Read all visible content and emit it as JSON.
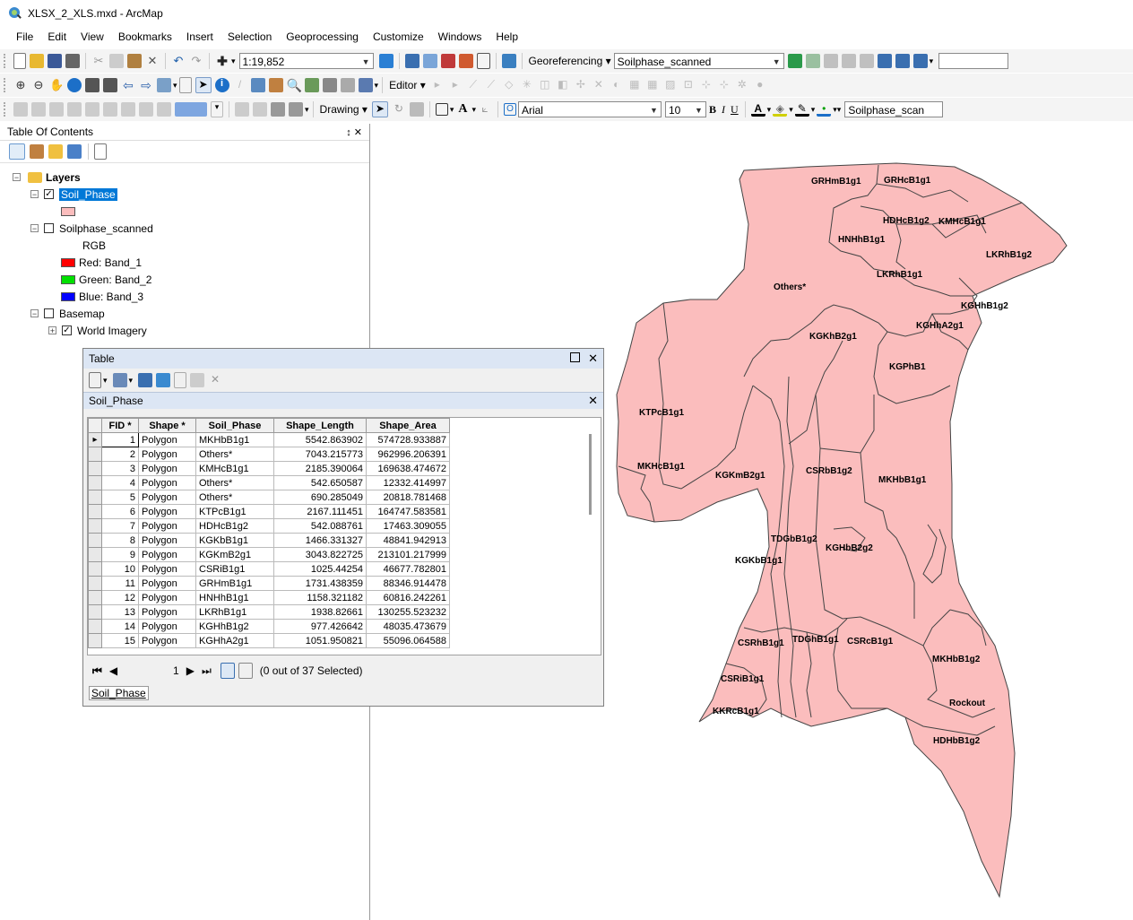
{
  "window": {
    "title": "XLSX_2_XLS.mxd - ArcMap"
  },
  "menu": [
    "File",
    "Edit",
    "View",
    "Bookmarks",
    "Insert",
    "Selection",
    "Geoprocessing",
    "Customize",
    "Windows",
    "Help"
  ],
  "toolbar": {
    "scale": "1:19,852",
    "georeferencing_label": "Georeferencing ▾",
    "georef_layer": "Soilphase_scanned",
    "editor_label": "Editor ▾",
    "drawing_label": "Drawing ▾",
    "font_name": "Arial",
    "font_size": "10",
    "bold": "B",
    "italic": "I",
    "underline": "U",
    "layer_combo": "Soilphase_scan"
  },
  "toc": {
    "title": "Table Of Contents",
    "pin": "↕ ✕",
    "layers_group": "Layers",
    "soil_phase": "Soil_Phase",
    "soilphase_scanned": "Soilphase_scanned",
    "rgb": "RGB",
    "red": "Red:   Band_1",
    "green": "Green: Band_2",
    "blue": "Blue:  Band_3",
    "basemap": "Basemap",
    "world_imagery": "World Imagery"
  },
  "table_window": {
    "title": "Table",
    "layer_tab": "Soil_Phase",
    "columns": [
      "FID *",
      "Shape *",
      "Soil_Phase",
      "Shape_Length",
      "Shape_Area"
    ],
    "rows": [
      [
        "1",
        "Polygon",
        "MKHbB1g1",
        "5542.863902",
        "574728.933887"
      ],
      [
        "2",
        "Polygon",
        "Others*",
        "7043.215773",
        "962996.206391"
      ],
      [
        "3",
        "Polygon",
        "KMHcB1g1",
        "2185.390064",
        "169638.474672"
      ],
      [
        "4",
        "Polygon",
        "Others*",
        "542.650587",
        "12332.414997"
      ],
      [
        "5",
        "Polygon",
        "Others*",
        "690.285049",
        "20818.781468"
      ],
      [
        "6",
        "Polygon",
        "KTPcB1g1",
        "2167.111451",
        "164747.583581"
      ],
      [
        "7",
        "Polygon",
        "HDHcB1g2",
        "542.088761",
        "17463.309055"
      ],
      [
        "8",
        "Polygon",
        "KGKbB1g1",
        "1466.331327",
        "48841.942913"
      ],
      [
        "9",
        "Polygon",
        "KGKmB2g1",
        "3043.822725",
        "213101.217999"
      ],
      [
        "10",
        "Polygon",
        "CSRiB1g1",
        "1025.44254",
        "46677.782801"
      ],
      [
        "11",
        "Polygon",
        "GRHmB1g1",
        "1731.438359",
        "88346.914478"
      ],
      [
        "12",
        "Polygon",
        "HNHhB1g1",
        "1158.321182",
        "60816.242261"
      ],
      [
        "13",
        "Polygon",
        "LKRhB1g1",
        "1938.82661",
        "130255.523232"
      ],
      [
        "14",
        "Polygon",
        "KGHhB1g2",
        "977.426642",
        "48035.473679"
      ],
      [
        "15",
        "Polygon",
        "KGHhA2g1",
        "1051.950821",
        "55096.064588"
      ]
    ],
    "nav_page": "1",
    "selection_status": "(0 out of 37 Selected)",
    "bottom_tab": "Soil_Phase"
  },
  "map_labels": [
    "GRHmB1g1",
    "GRHcB1g1",
    "HDHcB1g2",
    "KMHcB1g1",
    "HNHhB1g1",
    "LKRhB1g2",
    "LKRhB1g1",
    "Others*",
    "KGHhB1g2",
    "KGHhA2g1",
    "KGKhB2g1",
    "KGPhB1",
    "KTPcB1g1",
    "MKHcB1g1",
    "KGKmB2g1",
    "CSRbB1g2",
    "MKHbB1g1",
    "TDGbB1g2",
    "KGHbB2g2",
    "KGKbB1g1",
    "CSRhB1g1",
    "TDGhB1g1",
    "CSRcB1g1",
    "MKHbB1g2",
    "CSRiB1g1",
    "KKRcB1g1",
    "Rockout",
    "HDHbB1g2"
  ],
  "colors": {
    "polygon_fill": "#fbbdbd",
    "polygon_stroke": "#444444",
    "selection": "#0078d7",
    "red": "#ff0000",
    "green": "#00e000",
    "blue": "#0000ff"
  }
}
